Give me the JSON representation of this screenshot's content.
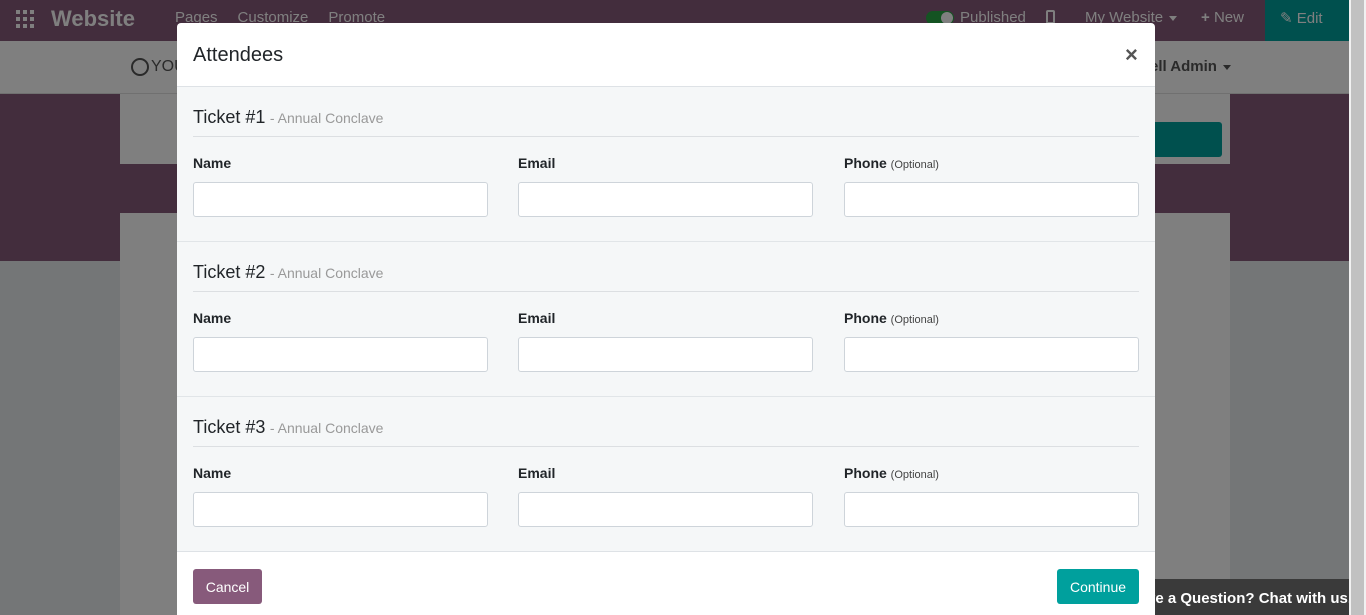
{
  "topbar": {
    "brand": "Website",
    "menu": [
      "Pages",
      "Customize",
      "Promote"
    ],
    "published_label": "Published",
    "site_label": "My Website",
    "new_label": "New",
    "edit_label": "Edit",
    "colors": {
      "bar": "#875a7b",
      "edit": "#00a09d",
      "toggle": "#28a745"
    }
  },
  "site_nav": {
    "logo_text": "YOU",
    "user_label": "ell Admin"
  },
  "chat": {
    "label": "ve a Question? Chat with us."
  },
  "modal": {
    "title": "Attendees",
    "close_label": "×",
    "tickets": [
      {
        "title": "Ticket #1",
        "event": "- Annual Conclave"
      },
      {
        "title": "Ticket #2",
        "event": "- Annual Conclave"
      },
      {
        "title": "Ticket #3",
        "event": "- Annual Conclave"
      }
    ],
    "fields": {
      "name_label": "Name",
      "email_label": "Email",
      "phone_label": "Phone",
      "optional_label": "(Optional)",
      "name_value": "",
      "email_value": "",
      "phone_value": ""
    },
    "cancel_label": "Cancel",
    "continue_label": "Continue",
    "colors": {
      "cancel": "#875a7b",
      "continue": "#00a09d",
      "section_bg": "#f5f7f8"
    }
  }
}
